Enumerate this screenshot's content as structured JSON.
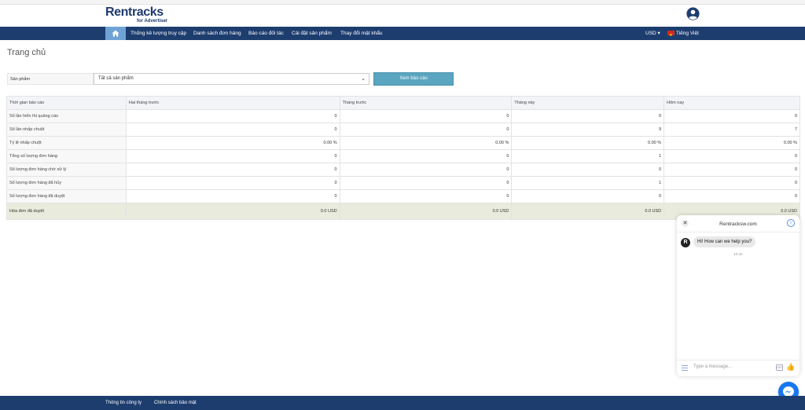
{
  "brand": {
    "name": "Rentracks",
    "sub": "for Advertiser"
  },
  "nav": {
    "items": [
      {
        "label": "Thống kê lượng truy cập"
      },
      {
        "label": "Danh sách đơn hàng"
      },
      {
        "label": "Báo cáo đối tác"
      },
      {
        "label": "Cài đặt sản phẩm"
      },
      {
        "label": "Thay đổi mật khẩu"
      }
    ],
    "currency": "USD ▾",
    "language": "Tiếng Việt"
  },
  "page": {
    "title": "Trang chủ"
  },
  "filter": {
    "label": "Sản phẩm",
    "selected": "Tất cả sản phẩm",
    "button": "Xem báo cáo"
  },
  "table": {
    "headers": [
      "Thời gian báo cáo",
      "Hai tháng trước",
      "Tháng trước",
      "Tháng này",
      "Hôm nay"
    ],
    "rows": [
      [
        "Số lần hiển thị quảng cáo",
        "0",
        "0",
        "0",
        "0"
      ],
      [
        "Số lần nhấp chuột",
        "0",
        "0",
        "9",
        "7"
      ],
      [
        "Tỷ lệ nhấp chuột",
        "0.00 %",
        "0.00 %",
        "0.00 %",
        "0.00 %"
      ],
      [
        "Tổng số lượng đơn hàng",
        "0",
        "0",
        "1",
        "0"
      ],
      [
        "Số lượng đơn hàng chờ xử lý",
        "0",
        "0",
        "0",
        "0"
      ],
      [
        "Số lượng đơn hàng đã hủy",
        "0",
        "0",
        "1",
        "0"
      ],
      [
        "Số lượng đơn hàng đã duyệt",
        "0",
        "0",
        "0",
        "0"
      ]
    ],
    "total": [
      "Hóa đơn đã duyệt",
      "0.0 USD",
      "0.0 USD",
      "0.0 USD",
      "0.0 USD"
    ]
  },
  "chat": {
    "title": "Rentracksw.com",
    "avatar": "R",
    "message": "Hi! How can we help you?",
    "time": "10:44",
    "placeholder": "Type a message..."
  },
  "footer": {
    "links": [
      {
        "label": "Thông tin công ty"
      },
      {
        "label": "Chính sách bảo mật"
      }
    ]
  }
}
